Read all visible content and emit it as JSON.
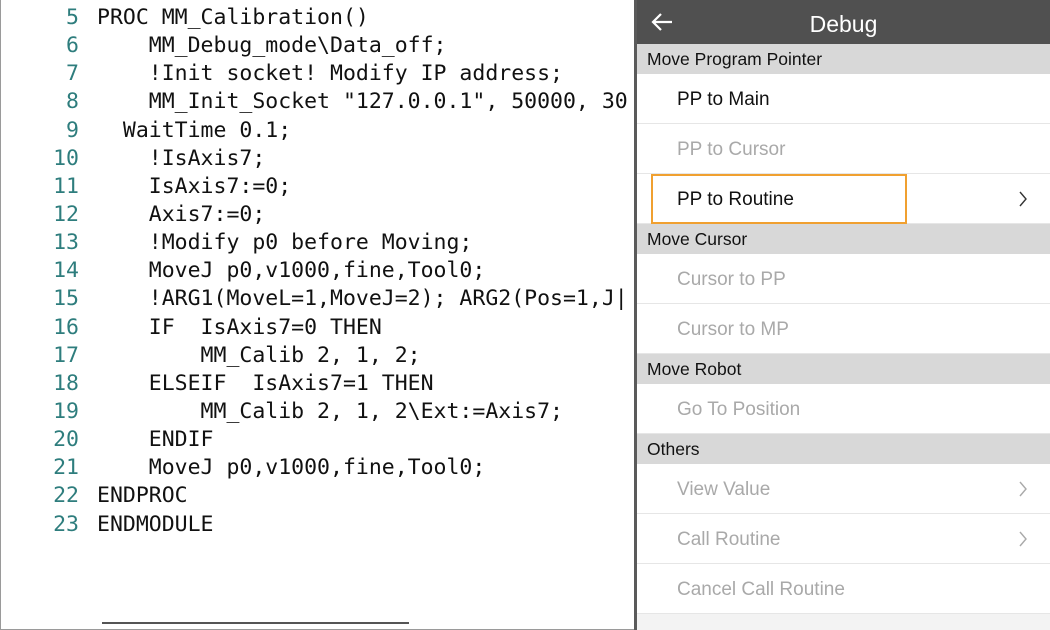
{
  "editor": {
    "lines": [
      {
        "num": "5",
        "text": "PROC MM_Calibration()"
      },
      {
        "num": "6",
        "text": "    MM_Debug_mode\\Data_off;"
      },
      {
        "num": "7",
        "text": "    !Init socket! Modify IP address;"
      },
      {
        "num": "8",
        "text": "    MM_Init_Socket \"127.0.0.1\", 50000, 30"
      },
      {
        "num": "9",
        "text": "  WaitTime 0.1;"
      },
      {
        "num": "10",
        "text": "    !IsAxis7;"
      },
      {
        "num": "11",
        "text": "    IsAxis7:=0;"
      },
      {
        "num": "12",
        "text": "    Axis7:=0;"
      },
      {
        "num": "13",
        "text": "    !Modify p0 before Moving;"
      },
      {
        "num": "14",
        "text": "    MoveJ p0,v1000,fine,Tool0;"
      },
      {
        "num": "15",
        "text": "    !ARG1(MoveL=1,MoveJ=2); ARG2(Pos=1,J|"
      },
      {
        "num": "16",
        "text": "    IF  IsAxis7=0 THEN"
      },
      {
        "num": "17",
        "text": "        MM_Calib 2, 1, 2;"
      },
      {
        "num": "18",
        "text": "    ELSEIF  IsAxis7=1 THEN"
      },
      {
        "num": "19",
        "text": "        MM_Calib 2, 1, 2\\Ext:=Axis7;"
      },
      {
        "num": "20",
        "text": "    ENDIF"
      },
      {
        "num": "21",
        "text": "    MoveJ p0,v1000,fine,Tool0;"
      },
      {
        "num": "22",
        "text": "ENDPROC"
      },
      {
        "num": "23",
        "text": "ENDMODULE"
      }
    ]
  },
  "debug": {
    "title": "Debug",
    "back_icon": "arrow-left-icon",
    "sections": [
      {
        "name": "move-program-pointer",
        "label": "Move Program Pointer",
        "items": [
          {
            "id": "pp-to-main",
            "label": "PP to Main",
            "enabled": true,
            "submenu": false
          },
          {
            "id": "pp-to-cursor",
            "label": "PP to Cursor",
            "enabled": false,
            "submenu": false
          },
          {
            "id": "pp-to-routine",
            "label": "PP to Routine",
            "enabled": true,
            "submenu": true,
            "focused": true
          }
        ]
      },
      {
        "name": "move-cursor",
        "label": "Move Cursor",
        "items": [
          {
            "id": "cursor-to-pp",
            "label": "Cursor to PP",
            "enabled": false,
            "submenu": false
          },
          {
            "id": "cursor-to-mp",
            "label": "Cursor to MP",
            "enabled": false,
            "submenu": false
          }
        ]
      },
      {
        "name": "move-robot",
        "label": "Move Robot",
        "items": [
          {
            "id": "go-to-position",
            "label": "Go To Position",
            "enabled": false,
            "submenu": false
          }
        ]
      },
      {
        "name": "others",
        "label": "Others",
        "items": [
          {
            "id": "view-value",
            "label": "View Value",
            "enabled": false,
            "submenu": true
          },
          {
            "id": "call-routine",
            "label": "Call Routine",
            "enabled": false,
            "submenu": true
          },
          {
            "id": "cancel-call-routine",
            "label": "Cancel Call Routine",
            "enabled": false,
            "submenu": false
          }
        ]
      }
    ]
  },
  "colors": {
    "header_bg": "#505050",
    "section_bg": "#d8d8d8",
    "focus_border": "#f0a030",
    "line_number": "#2e7d7d",
    "disabled_text": "#a9a9a9"
  }
}
